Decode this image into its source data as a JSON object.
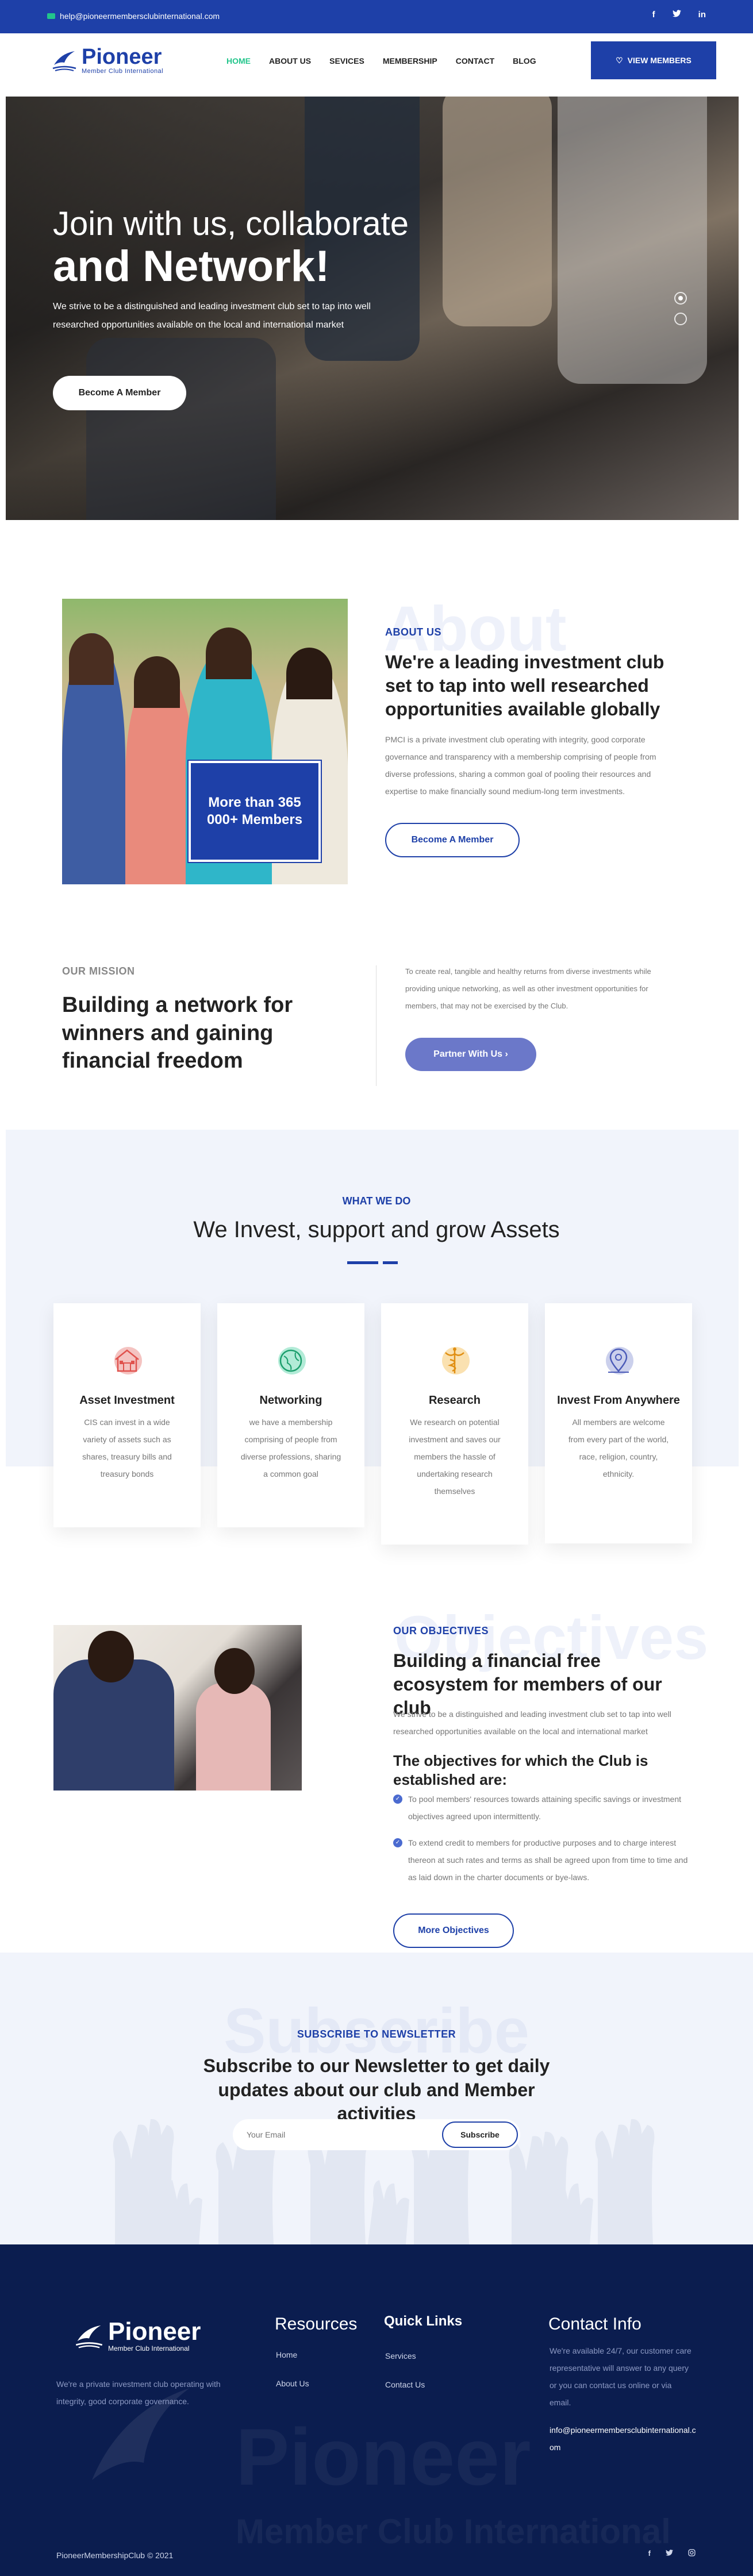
{
  "topbar": {
    "email": "help@pioneermembersclubinternational.com",
    "social": [
      "f",
      "t",
      "in"
    ]
  },
  "nav": {
    "logo_big": "Pioneer",
    "logo_small": "Member Club International",
    "items": [
      "HOME",
      "ABOUT US",
      "SEVICES",
      "MEMBERSHIP",
      "CONTACT",
      "BLOG"
    ],
    "active": "HOME",
    "cta": "VIEW MEMBERS"
  },
  "hero": {
    "line1": "Join with us, collaborate",
    "line2": "and Network!",
    "text": "We strive to be a distinguished and leading investment club set to tap into well researched opportunities available on the local and international market",
    "button": "Become A Member"
  },
  "about": {
    "ghost": "About",
    "eyebrow": "ABOUT US",
    "title": "We're a leading investment club set to tap into well researched opportunities available globally",
    "text": "PMCI is a private investment club operating with integrity, good corporate governance and transparency with a membership comprising of people from diverse professions, sharing a common goal of pooling their resources and expertise to make financially sound medium-long term investments.",
    "badge": "More than 365 000+ Members",
    "button": "Become A Member"
  },
  "mission": {
    "eyebrow": "OUR MISSION",
    "title": "Building a network for winners and gaining financial freedom",
    "text": "To create real, tangible and healthy returns from diverse investments while providing unique networking, as well as other investment opportunities for members, that may not be exercised by the Club.",
    "button": "Partner With Us"
  },
  "services": {
    "eyebrow": "WHAT WE DO",
    "title": "We Invest, support and grow Assets",
    "cards": [
      {
        "title": "Asset Investment",
        "text": "CIS can invest in a wide variety of assets such as shares, treasury bills and treasury bonds",
        "icon": "building-icon",
        "color": "#e0524d"
      },
      {
        "title": "Networking",
        "text": "we have a membership comprising of people from diverse professions, sharing a common goal",
        "icon": "globe-icon",
        "color": "#22c58b"
      },
      {
        "title": "Research",
        "text": "We research on potential investment and saves our members the hassle of undertaking research themselves",
        "icon": "caduceus-icon",
        "color": "#f2a81d"
      },
      {
        "title": "Invest From Anywhere",
        "text": "All members are welcome from every part of the world, race, religion, country, ethnicity.",
        "icon": "map-pin-icon",
        "color": "#6b78c9"
      }
    ]
  },
  "objectives": {
    "ghost": "Objectives",
    "eyebrow": "OUR OBJECTIVES",
    "title": "Building a financial free ecosystem for members of our club",
    "text": "We strive to be a distinguished and leading investment club set to tap into well researched opportunities available on the local and international market",
    "subtitle": "The objectives for which the Club is established are:",
    "items": [
      "To pool members' resources towards attaining specific savings or investment objectives agreed upon intermittently.",
      "To extend credit to members for productive purposes and to charge interest thereon at such rates and terms as shall be agreed upon from time to time and as laid down in the charter documents or bye-laws."
    ],
    "button": "More Objectives"
  },
  "subscribe": {
    "ghost": "Subscribe",
    "eyebrow": "SUBSCRIBE TO NEWSLETTER",
    "title": "Subscribe to our Newsletter to get daily updates about our club and Member activities",
    "placeholder": "Your Email",
    "button": "Subscribe"
  },
  "footer": {
    "logo_big": "Pioneer",
    "logo_small": "Member Club International",
    "about": "We're a private investment club operating with integrity, good corporate governance.",
    "resources_title": "Resources",
    "resources": [
      "Home",
      "About Us"
    ],
    "quick_title": "Quick Links",
    "quick": [
      "Services",
      "Contact Us"
    ],
    "contact_title": "Contact Info",
    "contact_text": "We're available 24/7, our customer care representative will answer to any query or you can contact us online or via email.",
    "contact_email": "info@pioneermembersclubinternational.com",
    "ghost_big": "Pioneer",
    "ghost_small": "Member Club International",
    "copyright": "PioneerMembershipClub © 2021",
    "social": [
      "f",
      "t",
      "ig"
    ]
  },
  "colors": {
    "brand_blue": "#1e40a8",
    "accent_green": "#22c58b",
    "footer_navy": "#0b1d4f"
  }
}
